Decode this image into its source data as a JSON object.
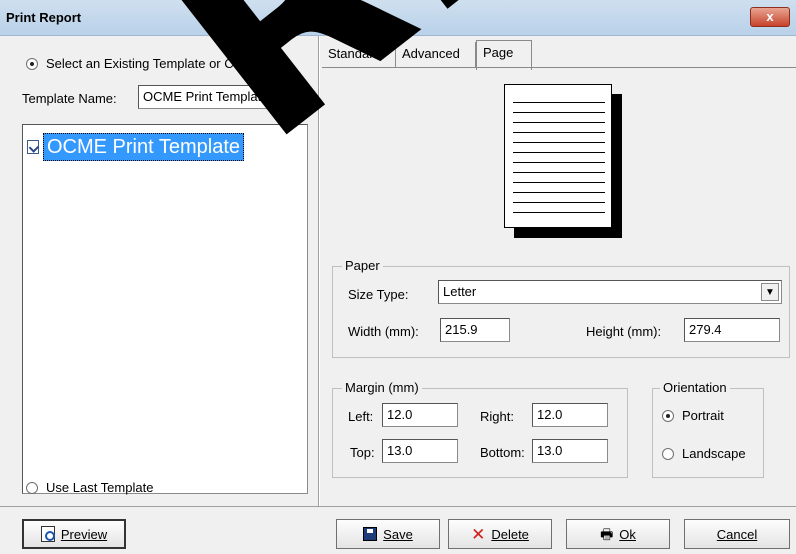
{
  "window": {
    "title": "Print Report",
    "close_glyph": "x"
  },
  "left": {
    "existing_option_label": "Select an Existing Template or Create One",
    "template_name_label": "Template Name:",
    "template_name_value": "OCME Print Template",
    "tree_item_label": "OCME Print Template",
    "last_template_label": "Use Last Template"
  },
  "tabs": [
    {
      "label": "Standard"
    },
    {
      "label": "Advanced"
    },
    {
      "label": "Page"
    }
  ],
  "paper": {
    "legend": "Paper",
    "size_type_label": "Size Type:",
    "size_type_value": "Letter",
    "width_label": "Width (mm):",
    "width_value": "215.9",
    "height_label": "Height (mm):",
    "height_value": "279.4"
  },
  "margin": {
    "legend": "Margin (mm)",
    "left_label": "Left:",
    "left_value": "12.0",
    "right_label": "Right:",
    "right_value": "12.0",
    "top_label": "Top:",
    "top_value": "13.0",
    "bottom_label": "Bottom:",
    "bottom_value": "13.0"
  },
  "orientation": {
    "legend": "Orientation",
    "portrait_label": "Portrait",
    "landscape_label": "Landscape"
  },
  "buttons": {
    "preview": "Preview",
    "save": "Save",
    "delete": "Delete",
    "ok": "Ok",
    "cancel": "Cancel"
  },
  "watermark": "REV",
  "colors": {
    "selection": "#3399ff",
    "close_button": "#c7432a"
  },
  "icons": {
    "preview": "magnifier-page-icon",
    "save": "floppy-disk-icon",
    "delete": "red-x-icon",
    "ok": "printer-icon",
    "tree_item": "checked-document-icon"
  }
}
